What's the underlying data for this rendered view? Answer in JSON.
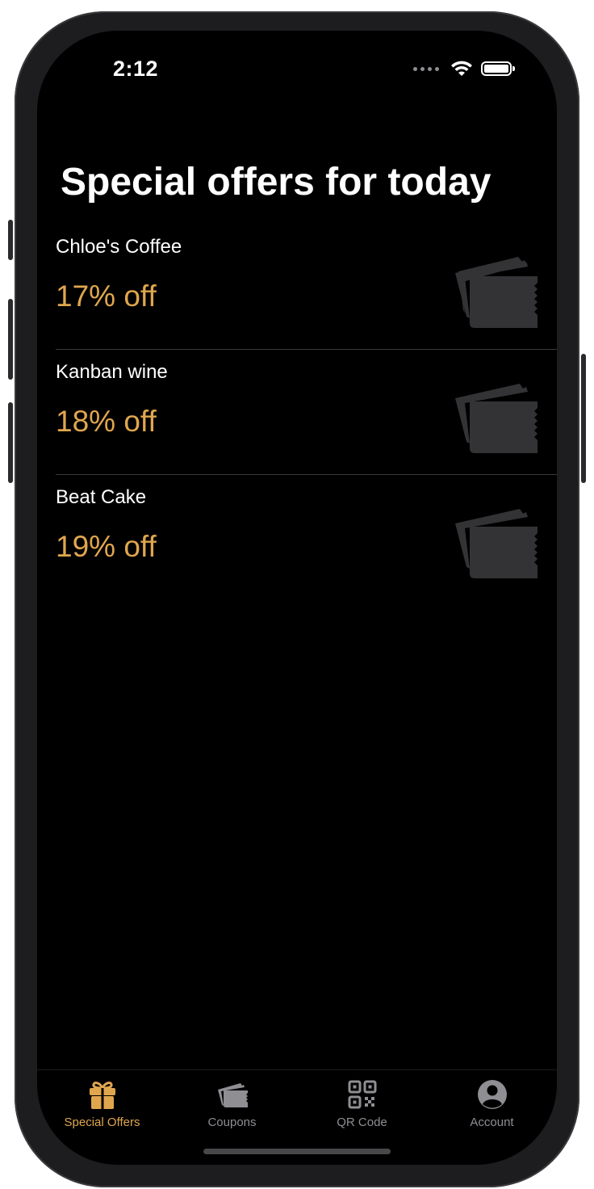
{
  "status_bar": {
    "time": "2:12"
  },
  "page": {
    "title": "Special offers for today"
  },
  "offers": [
    {
      "name": "Chloe's Coffee",
      "discount": "17% off",
      "icon": "ticket-icon"
    },
    {
      "name": "Kanban wine",
      "discount": "18% off",
      "icon": "ticket-icon"
    },
    {
      "name": "Beat Cake",
      "discount": "19% off",
      "icon": "ticket-icon"
    }
  ],
  "tabbar": {
    "tabs": [
      {
        "label": "Special Offers",
        "icon": "gift-icon",
        "active": true
      },
      {
        "label": "Coupons",
        "icon": "ticket-icon",
        "active": false
      },
      {
        "label": "QR Code",
        "icon": "qr-code-icon",
        "active": false
      },
      {
        "label": "Account",
        "icon": "person-circle-icon",
        "active": false
      }
    ]
  },
  "colors": {
    "background": "#000000",
    "accent": "#e0a64e",
    "inactive_tab": "#8e8e93",
    "ticket_icon": "#3a3a3c"
  }
}
